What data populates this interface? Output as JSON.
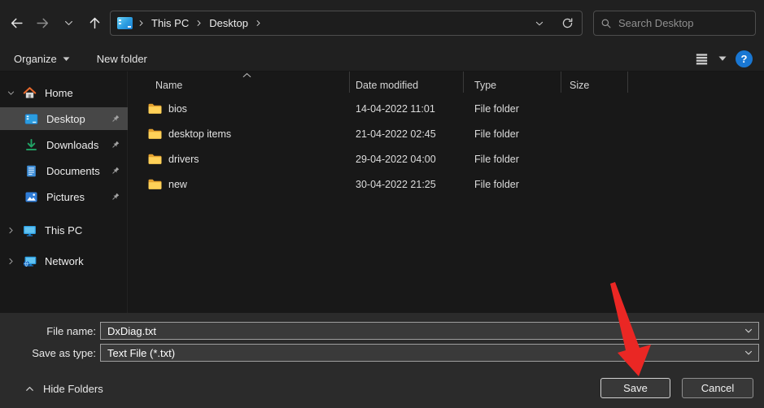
{
  "topbar": {
    "breadcrumb": {
      "items": [
        "This PC",
        "Desktop"
      ]
    },
    "search": {
      "placeholder": "Search Desktop"
    }
  },
  "toolbar": {
    "organize_label": "Organize",
    "new_folder_label": "New folder",
    "help_glyph": "?"
  },
  "sidebar": {
    "items": [
      {
        "label": "Home",
        "selected": false,
        "pinned": false
      },
      {
        "label": "Desktop",
        "selected": true,
        "pinned": true
      },
      {
        "label": "Downloads",
        "selected": false,
        "pinned": true
      },
      {
        "label": "Documents",
        "selected": false,
        "pinned": true
      },
      {
        "label": "Pictures",
        "selected": false,
        "pinned": true
      },
      {
        "label": "This PC",
        "selected": false,
        "pinned": false
      },
      {
        "label": "Network",
        "selected": false,
        "pinned": false
      }
    ]
  },
  "file_list": {
    "columns": [
      "Name",
      "Date modified",
      "Type",
      "Size"
    ],
    "sort": {
      "column": "Name",
      "direction": "ascending"
    },
    "rows": [
      {
        "name": "bios",
        "date_modified": "14-04-2022 11:01",
        "type": "File folder",
        "size": ""
      },
      {
        "name": "desktop items",
        "date_modified": "21-04-2022 02:45",
        "type": "File folder",
        "size": ""
      },
      {
        "name": "drivers",
        "date_modified": "29-04-2022 04:00",
        "type": "File folder",
        "size": ""
      },
      {
        "name": "new",
        "date_modified": "30-04-2022 21:25",
        "type": "File folder",
        "size": ""
      }
    ]
  },
  "footer": {
    "file_name_label": "File name:",
    "file_name_value": "DxDiag.txt",
    "save_as_type_label": "Save as type:",
    "save_as_type_value": "Text File (*.txt)",
    "hide_folders_label": "Hide Folders",
    "save_label": "Save",
    "cancel_label": "Cancel"
  },
  "colors": {
    "help_accent_blue": "#1977d3",
    "folder_yellow": "#fbc02d",
    "sidebar_selection_gray": "#474747",
    "annotation_arrow_red": "#ea2724"
  }
}
